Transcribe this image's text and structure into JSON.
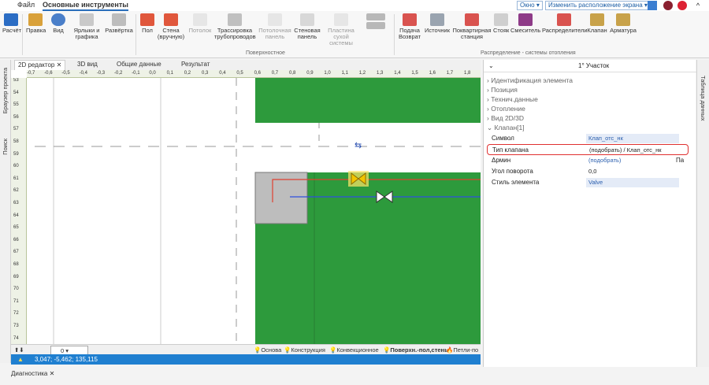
{
  "menu": {
    "file": "Файл",
    "main_tools": "Основные инструменты"
  },
  "topright": {
    "window_btn": "Окно",
    "layout_btn": "Изменить расположение экрана"
  },
  "ribbon": {
    "calc": "Расчёт",
    "edit": "Правка",
    "view": "Вид",
    "labels": "Ярлыки и\nграфика",
    "spread": "Развёртка",
    "floor": "Пол",
    "wall": "Стена\n(вручную)",
    "ceiling": "Потолок",
    "trace": "Трассировка\nтрубопроводов",
    "ceiling_panel": "Потолочная\nпанель",
    "wall_panel": "Стеновая\nпанель",
    "dry_plate": "Пластина\nсухой системы",
    "supply": "Подача\nВозврат",
    "source": "Источник",
    "station": "Поквартирная\nстанция",
    "riser": "Стояк",
    "mixer": "Смеситель",
    "distributors": "Распределители",
    "valve": "Клапан",
    "fittings": "Арматура",
    "group_surface": "Поверхностное",
    "group_heating": "Распределение - системы отопления"
  },
  "tabs": {
    "editor2d": "2D редактор",
    "view3d": "3D вид",
    "common": "Общие данные",
    "result": "Результат"
  },
  "leftbar": {
    "browser": "Браузер проекта",
    "search": "Поиск"
  },
  "hruler": [
    "-0,7",
    "-0,6",
    "-0,5",
    "-0,4",
    "-0,3",
    "-0,2",
    "-0,1",
    "0,0",
    "0,1",
    "0,2",
    "0,3",
    "0,4",
    "0,5",
    "0,6",
    "0,7",
    "0,8",
    "0,9",
    "1,0",
    "1,1",
    "1,2",
    "1,3",
    "1,4",
    "1,5",
    "1,6",
    "1,7",
    "1,8"
  ],
  "vruler": [
    "53",
    "54",
    "55",
    "56",
    "57",
    "58",
    "59",
    "60",
    "61",
    "62",
    "63",
    "64",
    "65",
    "66",
    "67",
    "68",
    "69",
    "70",
    "71",
    "72",
    "73",
    "74"
  ],
  "canvas_foot": {
    "layer_value": "0",
    "layers": [
      "Основа",
      "Конструкция",
      "Конвекционное",
      "Поверхн.-пол,стены",
      "Петли-по"
    ]
  },
  "status": {
    "coords": "3,047; -5,462; 135,115"
  },
  "bottom_tab": "Диагностика",
  "props": {
    "title": "1° Участок",
    "sections": [
      "Идентификация элемента",
      "Позиция",
      "Технич.данные",
      "Отопление",
      "Вид 2D/3D",
      "Клапан[1]"
    ],
    "rows": [
      {
        "label": "Символ",
        "value": "Клап_отс_нк"
      },
      {
        "label": "Тип клапана",
        "value": "(подобрать) / Клап_отс_нк"
      },
      {
        "label": "Δpмин",
        "value": "(подобрать)",
        "suffix": "Па"
      },
      {
        "label": "Угол поворота",
        "value": "0,0"
      },
      {
        "label": "Стиль элемента",
        "value": "Valve"
      }
    ]
  },
  "rightbar": {
    "table": "Таблица данных"
  },
  "colors": {
    "accent": "#1f7fd0",
    "green": "#2d9a3c",
    "highlight": "#e03030"
  }
}
